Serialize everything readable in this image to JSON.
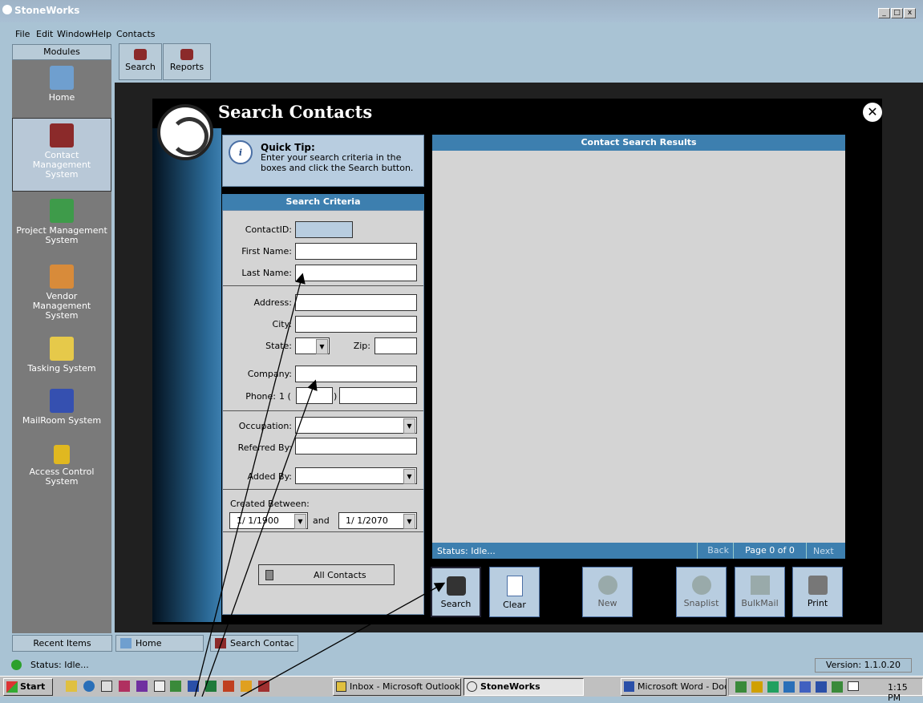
{
  "app": {
    "title": "StoneWorks",
    "min": "_",
    "max": "□",
    "close": "x"
  },
  "menu": [
    "File",
    "Edit",
    "Window",
    "Help",
    "Contacts"
  ],
  "toolbar": {
    "search": "Search",
    "reports": "Reports"
  },
  "sidebar": {
    "header": "Modules",
    "items": [
      {
        "label": "Home"
      },
      {
        "label": "Contact Management System"
      },
      {
        "label": "Project Management System"
      },
      {
        "label": "Vendor Management System"
      },
      {
        "label": "Tasking System"
      },
      {
        "label": "MailRoom System"
      },
      {
        "label": "Access Control System"
      }
    ],
    "recent": "Recent Items"
  },
  "dialog": {
    "title": "Search Contacts",
    "close": "✕",
    "tip": {
      "icon": "i",
      "title": "Quick Tip:",
      "text": "Enter your search criteria in the boxes and click the Search button."
    },
    "criteria": {
      "header": "Search Criteria",
      "contact_id": "ContactID:",
      "first_name": "First Name:",
      "last_name": "Last Name:",
      "address": "Address:",
      "city": "City:",
      "state": "State:",
      "zip": "Zip:",
      "company": "Company:",
      "phone": "Phone:",
      "phone_prefix": "1 (",
      "phone_close": ")",
      "occupation": "Occupation:",
      "referred_by": "Referred By:",
      "added_by": "Added By:",
      "created_between": "Created Between:",
      "date_from": "1/ 1/1900",
      "and": "and",
      "date_to": "1/ 1/2070",
      "all_contacts": "All Contacts"
    },
    "results": {
      "header": "Contact Search Results",
      "status": "Status: Idle...",
      "back": "Back",
      "page": "Page 0 of 0",
      "next": "Next"
    },
    "buttons": {
      "search": "Search",
      "clear": "Clear",
      "new": "New",
      "snaplist": "Snaplist",
      "bulkmail": "BulkMail",
      "print": "Print"
    }
  },
  "tabs": {
    "home": "Home",
    "search_contacts": "Search Contac"
  },
  "status": {
    "text": "Status: Idle...",
    "version": "Version: 1.1.0.20"
  },
  "taskbar": {
    "start": "Start",
    "outlook": "Inbox - Microsoft Outlook",
    "stoneworks": "StoneWorks",
    "word": "Microsoft Word - Docu...",
    "clock": "1:15 PM"
  },
  "colors": {
    "accent": "#3d7faf",
    "panel": "#d4d4d4",
    "tip": "#b8cde0"
  }
}
